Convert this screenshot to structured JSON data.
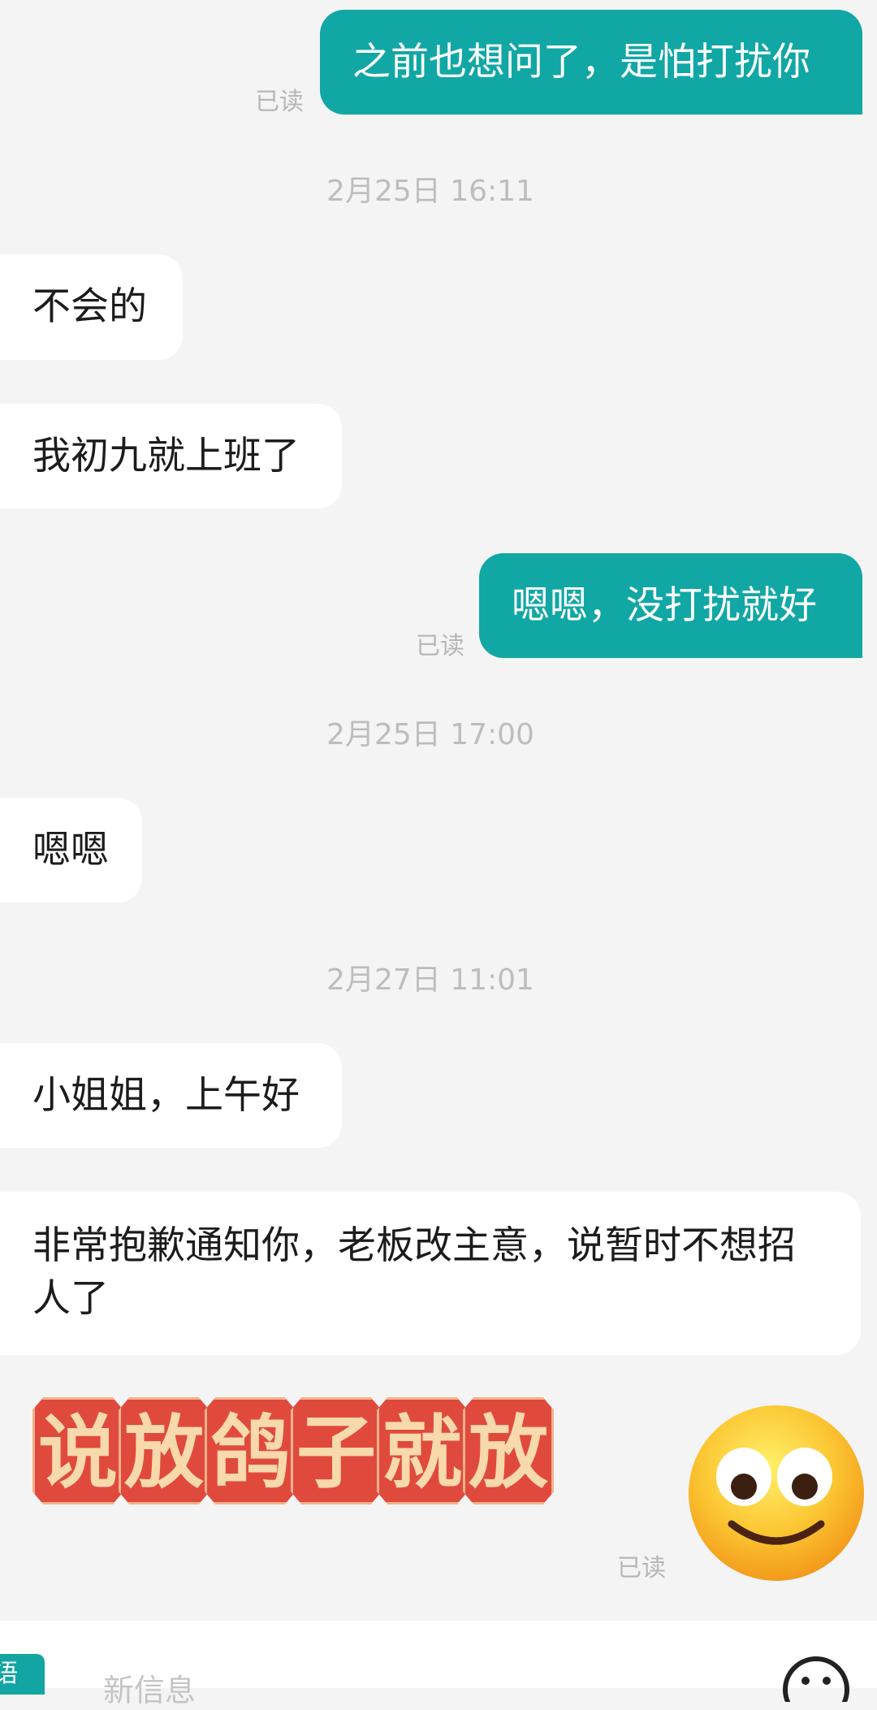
{
  "messages": [
    {
      "text": "之前也想问了，是怕打扰你",
      "read": "已读"
    },
    {
      "text": "不会的"
    },
    {
      "text": "我初九就上班了"
    },
    {
      "text": "嗯嗯，没打扰就好",
      "read": "已读"
    },
    {
      "text": "嗯嗯"
    },
    {
      "text": "小姐姐，上午好"
    },
    {
      "text": "非常抱歉通知你，老板改主意，说暂时不想招人了"
    }
  ],
  "timestamps": [
    "2月25日 16:11",
    "2月25日 17:00",
    "2月27日 11:01"
  ],
  "sticker": {
    "chars": [
      "说",
      "放",
      "鸽",
      "子",
      "就",
      "放"
    ],
    "read": "已读"
  },
  "input": {
    "placeholder": "新信息",
    "left_badge": "语"
  },
  "colors": {
    "outgoing": "#11a7a5",
    "incoming": "#ffffff",
    "background": "#f4f4f4"
  },
  "icons": [
    "smiley-emoji-icon",
    "emoji-button-icon"
  ]
}
